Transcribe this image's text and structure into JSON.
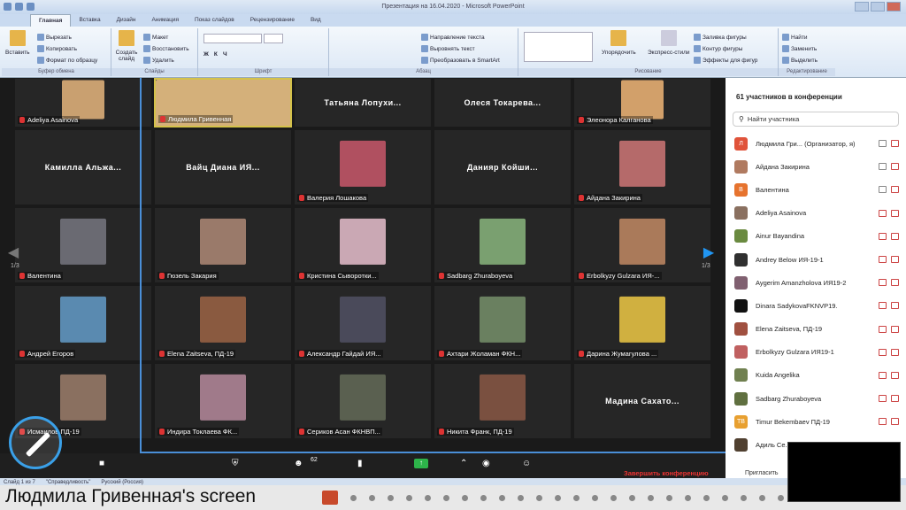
{
  "ppt": {
    "title": "Презентация на 16.04.2020 - Microsoft PowerPoint",
    "tabs": [
      "Главная",
      "Вставка",
      "Дизайн",
      "Анимация",
      "Показ слайдов",
      "Рецензирование",
      "Вид"
    ],
    "groups": {
      "clipboard": {
        "label": "Буфер обмена",
        "paste": "Вставить",
        "cut": "Вырезать",
        "copy": "Копировать",
        "format": "Формат по образцу"
      },
      "slides": {
        "label": "Слайды",
        "new": "Создать слайд",
        "layout": "Макет",
        "reset": "Восстановить",
        "delete": "Удалить"
      },
      "font": {
        "label": "Шрифт"
      },
      "paragraph": {
        "label": "Абзац",
        "text_dir": "Направление текста",
        "align": "Выровнять текст",
        "smartart": "Преобразовать в SmartArt"
      },
      "drawing": {
        "label": "Рисование",
        "arrange": "Упорядочить",
        "styles": "Экспресс-стили",
        "fill": "Заливка фигуры",
        "outline": "Контур фигуры",
        "effects": "Эффекты для фигур"
      },
      "editing": {
        "label": "Редактирование",
        "find": "Найти",
        "replace": "Заменить",
        "select": "Выделить"
      }
    },
    "status": [
      "Слайд 1 из 7",
      "\"Справедливость\"",
      "Русский (Россия)"
    ]
  },
  "gallery": {
    "page_left": "1/3",
    "page_right": "1/3",
    "tiles": [
      {
        "name": "Adeliya Asainova",
        "type": "photo"
      },
      {
        "name": "Людмила Гривенная",
        "type": "photo",
        "speaker": true
      },
      {
        "name": "Татьяна Лопухи...",
        "type": "text"
      },
      {
        "name": "Олеся Токарева...",
        "type": "text"
      },
      {
        "name": "Элеонора Калганова",
        "type": "photo"
      },
      {
        "name": "Камилла Альжа...",
        "type": "text"
      },
      {
        "name": "Вайц Диана ИЯ...",
        "type": "text"
      },
      {
        "name": "Валерия Лошакова",
        "type": "photo"
      },
      {
        "name": "Данияр Койши...",
        "type": "text"
      },
      {
        "name": "Айдана Закирина",
        "type": "photo"
      },
      {
        "name": "Валентина",
        "type": "photo"
      },
      {
        "name": "Гюзель Закария",
        "type": "photo"
      },
      {
        "name": "Кристина Сыворотки...",
        "type": "photo"
      },
      {
        "name": "Sadbarg Zhuraboyeva",
        "type": "photo"
      },
      {
        "name": "Erbolkyzy Gulzara ИЯ-...",
        "type": "photo"
      },
      {
        "name": "Андрей Егоров",
        "type": "photo"
      },
      {
        "name": "Elena Zaitseva, ПД-19",
        "type": "photo"
      },
      {
        "name": "Александр Гайдай ИЯ...",
        "type": "photo"
      },
      {
        "name": "Ахтари Жоламан ФКН...",
        "type": "photo"
      },
      {
        "name": "Дарина Жумагулова ...",
        "type": "photo"
      },
      {
        "name": "Исмаилов ПД-19",
        "type": "photo"
      },
      {
        "name": "Индира Токлаева ФК...",
        "type": "photo"
      },
      {
        "name": "Сериков Асан ФКНВП...",
        "type": "photo"
      },
      {
        "name": "Никита Франк, ПД-19",
        "type": "photo"
      },
      {
        "name": "Мадина Сахато...",
        "type": "text"
      }
    ]
  },
  "participants": {
    "title": "61 участников в конференции",
    "search_placeholder": "Найти участника",
    "items": [
      {
        "name": "Людмила Гри... (Организатор, я)",
        "initial": "Л",
        "color": "#e0533a"
      },
      {
        "name": "Айдана Закирина",
        "initial": "",
        "color": "#b07a60"
      },
      {
        "name": "Валентина",
        "initial": "В",
        "color": "#e6732e"
      },
      {
        "name": "Adeliya Asainova",
        "initial": "",
        "color": "#8a7060"
      },
      {
        "name": "Ainur Bayandina",
        "initial": "",
        "color": "#6a8a40"
      },
      {
        "name": "Andrey Below ИЯ-19-1",
        "initial": "",
        "color": "#303030"
      },
      {
        "name": "Aygerim Amanzholova ИЯ19-2",
        "initial": "",
        "color": "#806070"
      },
      {
        "name": "Dinara SadykovaFKNVP19.",
        "initial": "",
        "color": "#111111"
      },
      {
        "name": "Elena Zaitseva, ПД-19",
        "initial": "",
        "color": "#a05040"
      },
      {
        "name": "Erbolkyzy Gulzara ИЯ19-1",
        "initial": "",
        "color": "#c06060"
      },
      {
        "name": "Kuida Angelika",
        "initial": "",
        "color": "#708050"
      },
      {
        "name": "Sadbarg Zhuraboyeva",
        "initial": "",
        "color": "#607040"
      },
      {
        "name": "Timur Bekembaev ПД-19",
        "initial": "TB",
        "color": "#e8a030"
      },
      {
        "name": "Адиль Се...",
        "initial": "",
        "color": "#504030"
      }
    ],
    "invite": "Пригласить"
  },
  "toolbar": {
    "participants_count": "62",
    "end": "Завершить конференцию"
  },
  "share": {
    "label": "Людмила Гривенная's screen"
  }
}
